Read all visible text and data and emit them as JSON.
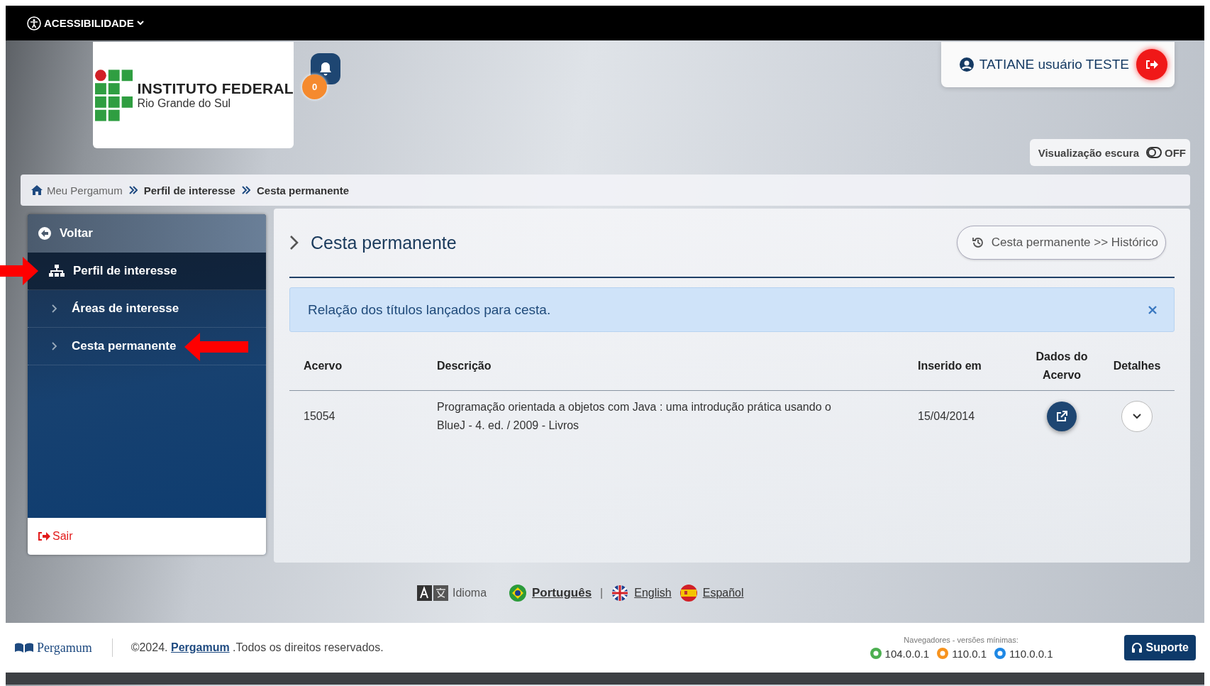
{
  "accessibility_bar": {
    "label": "ACESSIBILIDADE"
  },
  "header": {
    "logo": {
      "title": "INSTITUTO FEDERAL",
      "subtitle": "Rio Grande do Sul"
    },
    "notifications": {
      "count": "0"
    },
    "user": {
      "name": "TATIANE usuário TESTE"
    },
    "dark_mode": {
      "label": "Visualização escura",
      "on": false,
      "state_text": "OFF"
    }
  },
  "breadcrumbs": [
    {
      "label": "Meu Pergamum",
      "kind": "home"
    },
    {
      "label": "Perfil de interesse",
      "kind": "link"
    },
    {
      "label": "Cesta permanente",
      "kind": "link"
    }
  ],
  "sidebar": {
    "back": "Voltar",
    "items": [
      {
        "label": "Perfil de interesse",
        "selected": true,
        "annotated": true,
        "children": [
          {
            "label": "Áreas de interesse",
            "selected": false,
            "annotated": false
          },
          {
            "label": "Cesta permanente",
            "selected": false,
            "annotated": true
          }
        ]
      }
    ],
    "logout": "Sair"
  },
  "main": {
    "title": "Cesta permanente",
    "history_button": "Cesta permanente >> Histórico",
    "alert": "Relação dos títulos lançados para cesta.",
    "table": {
      "columns": [
        "Acervo",
        "Descrição",
        "Inserido em",
        "Dados do Acervo",
        "Detalhes"
      ],
      "rows": [
        {
          "acervo": "15054",
          "descricao": "Programação orientada a objetos com Java : uma introdução prática usando o BlueJ - 4. ed. / 2009 - Livros",
          "inserido_em": "15/04/2014"
        }
      ]
    }
  },
  "languages": {
    "label": "Idioma",
    "items": [
      {
        "kind": "language",
        "label": "Português",
        "selected": true
      },
      {
        "kind": "separator",
        "label": "|"
      },
      {
        "kind": "language",
        "label": "English",
        "selected": false
      },
      {
        "kind": "language",
        "label": "Español",
        "selected": false
      }
    ]
  },
  "footer": {
    "brand": "Pergamum",
    "copyright_before": "©2024.",
    "copyright_link": "Pergamum",
    "copyright_after": ".Todos os direitos reservados.",
    "browsers_title": "Navegadores - versões mínimas:",
    "browsers": [
      {
        "version": "104.0.0.1",
        "color": "#4caf50"
      },
      {
        "version": "110.0.1",
        "color": "#f7931e"
      },
      {
        "version": "110.0.0.1",
        "color": "#1e88e5"
      }
    ],
    "support": "Suporte"
  }
}
